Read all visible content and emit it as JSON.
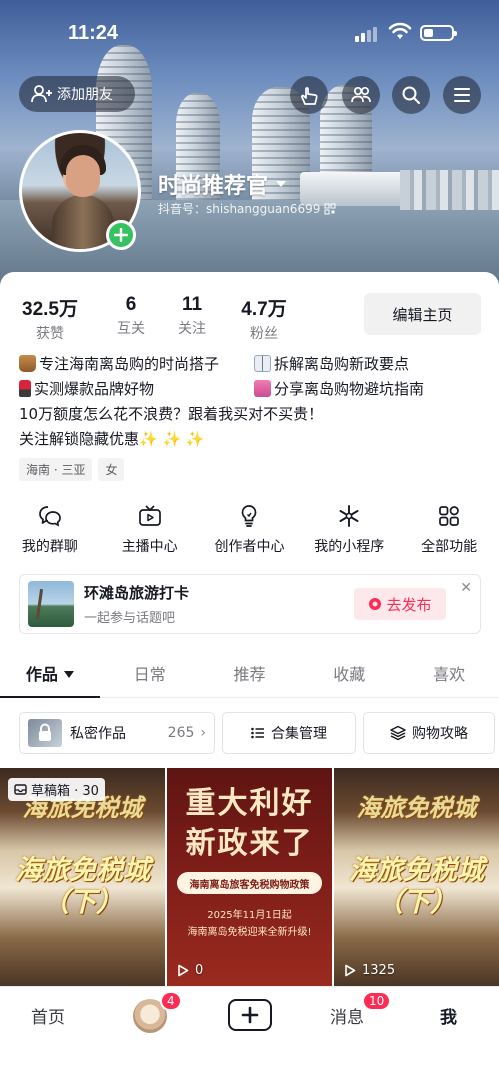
{
  "status_bar": {
    "time": "11:24"
  },
  "header": {
    "add_friend_label": "添加朋友",
    "nickname": "时尚推荐官",
    "douyin_id": "抖音号：shishangguan6699"
  },
  "stats": [
    {
      "value": "32.5万",
      "label": "获赞"
    },
    {
      "value": "6",
      "label": "互关"
    },
    {
      "value": "11",
      "label": "关注"
    },
    {
      "value": "4.7万",
      "label": "粉丝"
    }
  ],
  "edit_profile_label": "编辑主页",
  "bio": {
    "line1_a": "专注海南离岛购的时尚搭子",
    "line1_b": "拆解离岛购新政要点",
    "line2_a": "实测爆款品牌好物",
    "line2_b": "分享离岛购物避坑指南",
    "line3": "10万额度怎么花不浪费？跟着我买对不买贵！",
    "line4": "关注解锁隐藏优惠",
    "line4_emoji": "✨ ✨ ✨"
  },
  "tags": [
    "海南 · 三亚",
    "女"
  ],
  "tools": [
    {
      "label": "我的群聊",
      "icon": "group-chat-icon"
    },
    {
      "label": "主播中心",
      "icon": "tv-play-icon"
    },
    {
      "label": "创作者中心",
      "icon": "lightbulb-icon"
    },
    {
      "label": "我的小程序",
      "icon": "asterisk-icon"
    },
    {
      "label": "全部功能",
      "icon": "grid-apps-icon"
    }
  ],
  "topic_card": {
    "title": "环滩岛旅游打卡",
    "subtitle": "一起参与话题吧",
    "post_label": "去发布"
  },
  "content_tabs": [
    "作品",
    "日常",
    "推荐",
    "收藏",
    "喜欢"
  ],
  "subbar": {
    "private_label": "私密作品",
    "private_count": "265",
    "collection_label": "合集管理",
    "guide_label": "购物攻略"
  },
  "grid": {
    "draft_label": "草稿箱 · 30",
    "cell1_title_top": "海旅免税城",
    "cell1_title_big": "海旅免税城",
    "cell1_sub": "（下）",
    "cell2_title1": "重大利好",
    "cell2_title2": "新政来了",
    "cell2_pill": "海南离岛旅客免税购物政策",
    "cell2_date": "2025年11月1日起",
    "cell2_desc": "海南离岛免税迎来全新升级!",
    "cell2_plays": "0",
    "cell3_title_top": "海旅免税城",
    "cell3_title_big": "海旅免税城",
    "cell3_sub": "（下）",
    "cell3_plays": "1325"
  },
  "bottom_nav": {
    "home": "首页",
    "friends_badge": "4",
    "messages": "消息",
    "messages_badge": "10",
    "me": "我"
  },
  "colors": {
    "accent": "#fe2c55",
    "online_green": "#36c35f"
  }
}
